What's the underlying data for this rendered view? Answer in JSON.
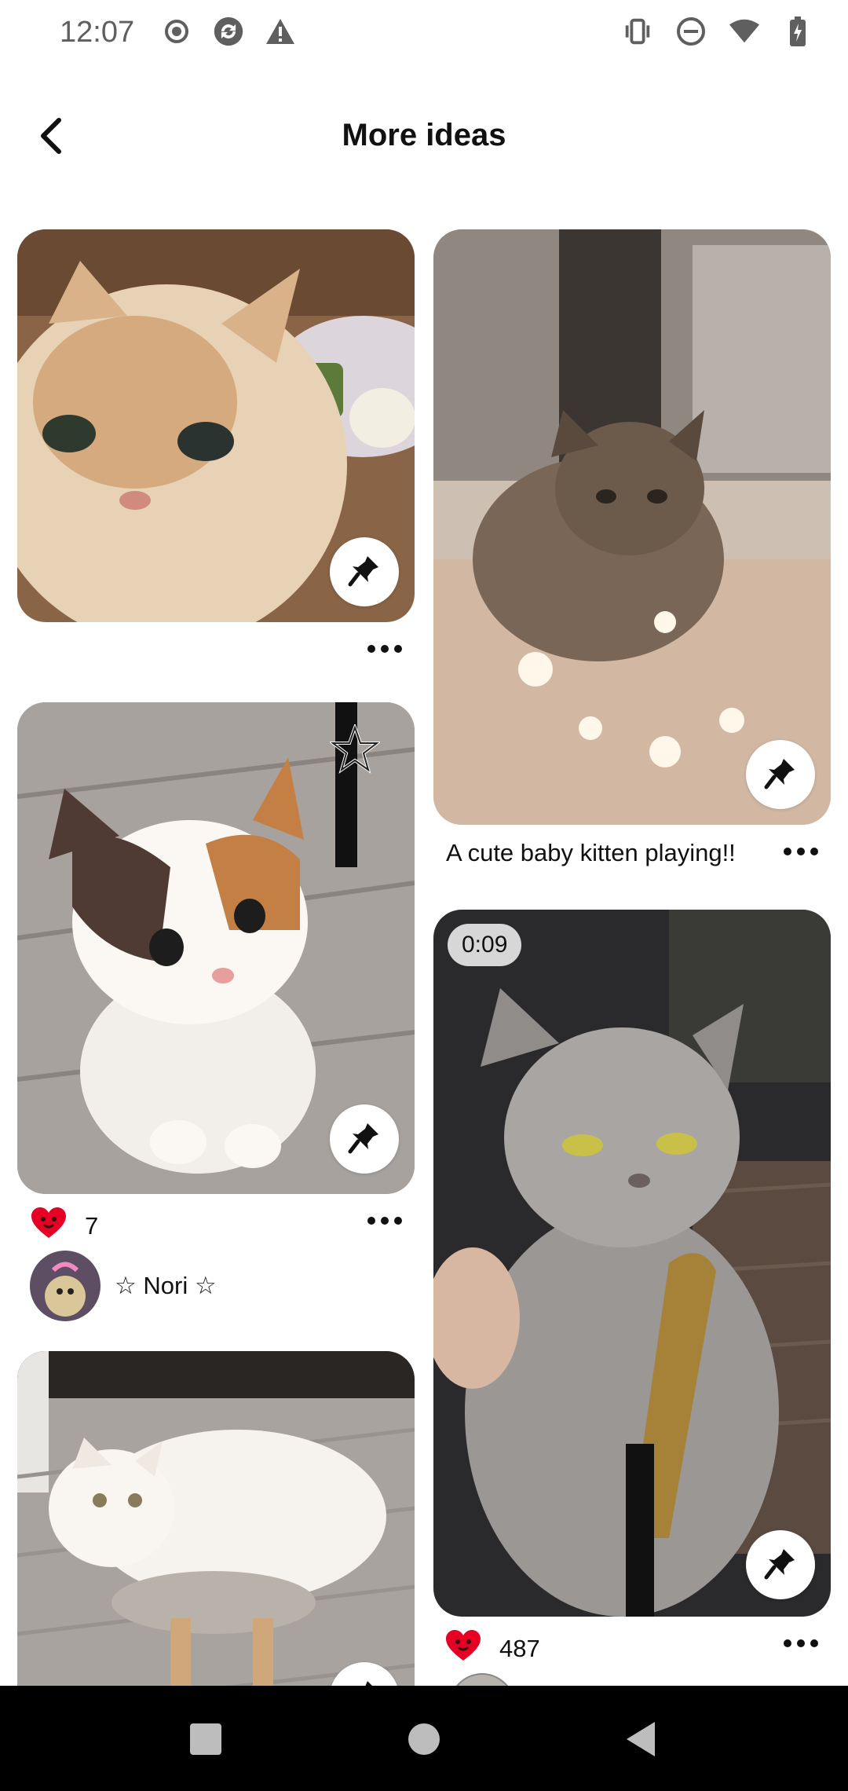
{
  "status_bar": {
    "time": "12:07",
    "left_icons": [
      "record-icon",
      "sync-icon",
      "warning-icon"
    ],
    "right_icons": [
      "vibrate-icon",
      "do-not-disturb-icon",
      "wifi-icon",
      "battery-charging-icon"
    ]
  },
  "header": {
    "title": "More ideas",
    "back_icon": "chevron-left-icon"
  },
  "pins": [
    {
      "id": "pin1",
      "caption": "",
      "save_icon": "pin-icon"
    },
    {
      "id": "pin2",
      "caption": "A cute baby kitten playing!!",
      "save_icon": "pin-icon"
    },
    {
      "id": "pin3",
      "reactions": "7",
      "reaction_icon": "heart-icon",
      "author": "☆ Nori ☆",
      "badge_icon": "star-icon"
    },
    {
      "id": "pin4",
      "video_duration": "0:09",
      "reactions": "487",
      "reaction_icon": "heart-icon"
    },
    {
      "id": "pin5"
    }
  ],
  "nav_bar": {
    "buttons": [
      "recents-square-icon",
      "home-circle-icon",
      "back-triangle-icon"
    ]
  },
  "colors": {
    "background": "#ffffff",
    "heart": "#e60023",
    "nav_bar": "#000000",
    "text": "#111111"
  }
}
